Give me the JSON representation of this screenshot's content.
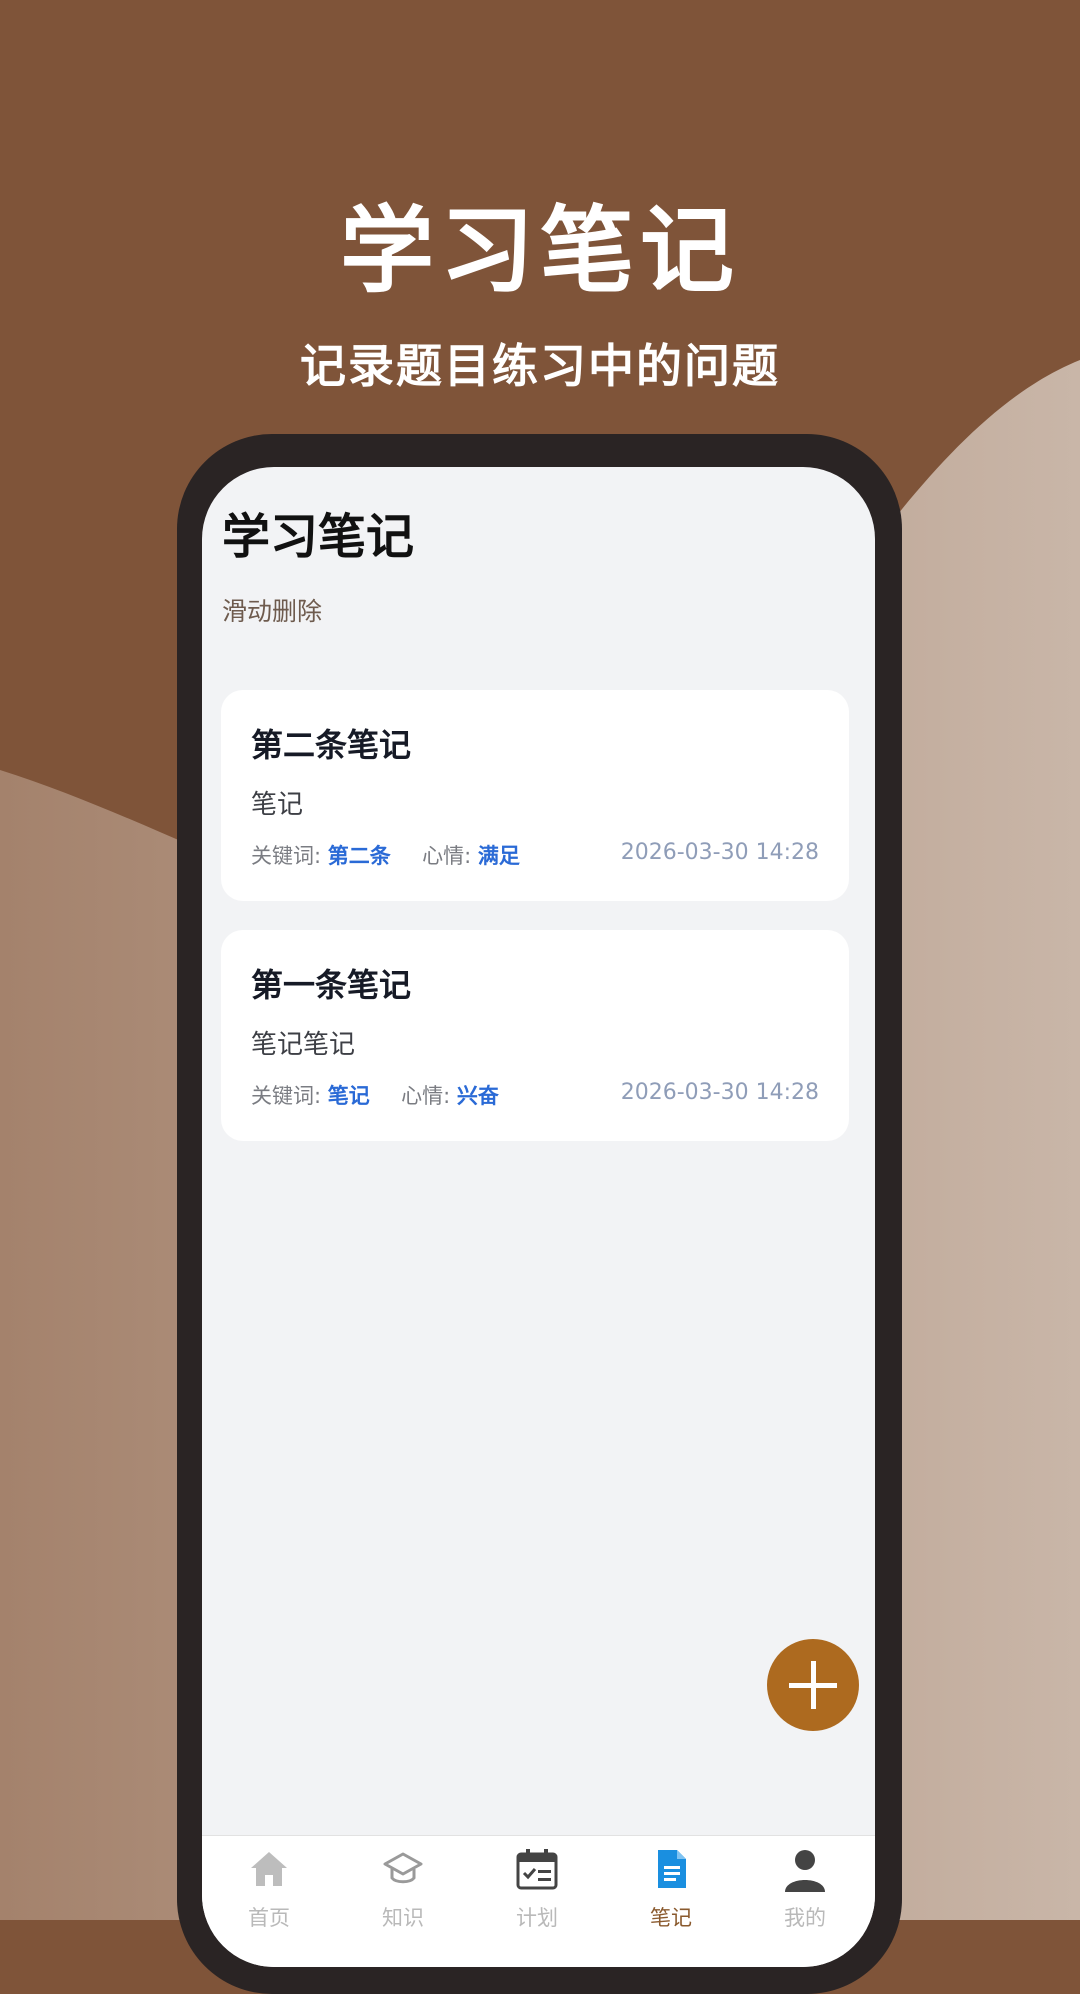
{
  "hero": {
    "title": "学习笔记",
    "subtitle": "记录题目练习中的问题"
  },
  "page": {
    "title": "学习笔记",
    "hint": "滑动删除"
  },
  "labels": {
    "keyword": "关键词:",
    "mood": "心情:"
  },
  "notes": [
    {
      "title": "第二条笔记",
      "content": "笔记",
      "keyword": "第二条",
      "mood": "满足",
      "date": "2026-03-30 14:28"
    },
    {
      "title": "第一条笔记",
      "content": "笔记笔记",
      "keyword": "笔记",
      "mood": "兴奋",
      "date": "2026-03-30 14:28"
    }
  ],
  "fab": {
    "icon": "plus-icon"
  },
  "tabs": [
    {
      "label": "首页",
      "icon": "home-icon"
    },
    {
      "label": "知识",
      "icon": "graduation-cap-icon"
    },
    {
      "label": "计划",
      "icon": "calendar-check-icon"
    },
    {
      "label": "笔记",
      "icon": "document-icon"
    },
    {
      "label": "我的",
      "icon": "person-icon"
    }
  ],
  "colors": {
    "brand_brown": "#7f5439",
    "accent_orange": "#ad6a1f",
    "keyword_blue": "#2a6ad6",
    "active_tab_icon": "#1a8fe0"
  }
}
